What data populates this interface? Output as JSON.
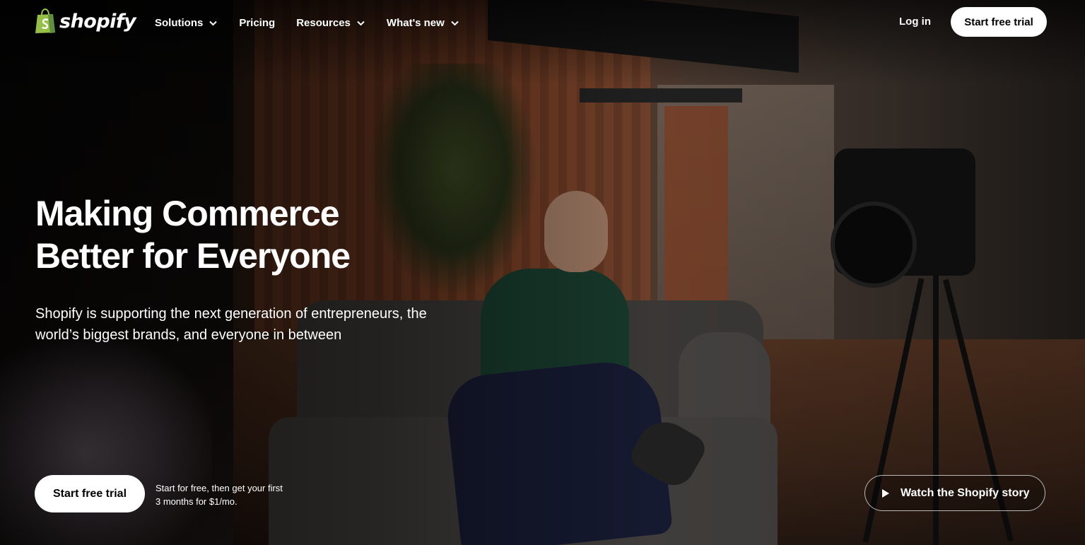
{
  "header": {
    "logo_text": "shopify",
    "nav": [
      {
        "label": "Solutions",
        "has_dropdown": true
      },
      {
        "label": "Pricing",
        "has_dropdown": false
      },
      {
        "label": "Resources",
        "has_dropdown": true
      },
      {
        "label": "What's new",
        "has_dropdown": true
      }
    ],
    "login_label": "Log in",
    "trial_label": "Start free trial"
  },
  "hero": {
    "title_line1": "Making Commerce",
    "title_line2": "Better for Everyone",
    "subtitle": "Shopify is supporting the next generation of entrepreneurs, the world’s biggest brands, and everyone in between",
    "cta_label": "Start free trial",
    "cta_note": "Start for free, then get your first 3 months for $1/mo.",
    "watch_label": "Watch the Shopify story"
  },
  "colors": {
    "brand_green": "#95bf47",
    "brand_dark_green": "#5e8e3e",
    "button_bg": "#ffffff",
    "button_text": "#000000"
  },
  "icons": {
    "logo": "shopping-bag-icon",
    "dropdown": "chevron-down-icon",
    "watch": "play-icon"
  }
}
